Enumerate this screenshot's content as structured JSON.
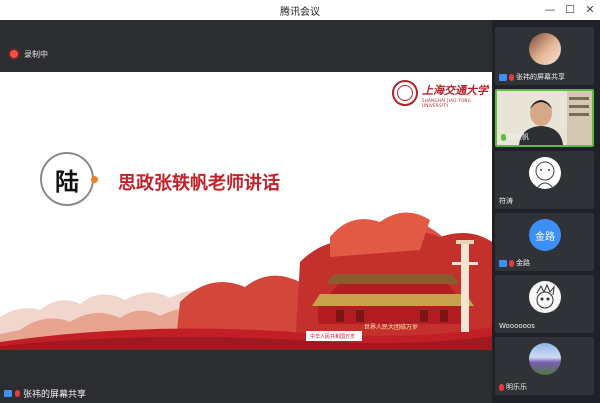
{
  "window": {
    "title": "腾讯会议"
  },
  "recording": {
    "label": "录制中"
  },
  "slide": {
    "logo_cn": "上海交通大学",
    "logo_en": "SHANGHAI JIAO TONG UNIVERSITY",
    "circle_char": "陆",
    "title": "思政张轶帆老师讲话",
    "banner_text": "世界人民大团结万岁",
    "banner_text2": "中华人民共和国万岁"
  },
  "participants": [
    {
      "name": "张祎的屏幕共享",
      "avatar": "photo-avatar",
      "sharing": true
    },
    {
      "name": "张轶帆",
      "avatar": "camera-video",
      "active": true
    },
    {
      "name": "符涛",
      "avatar": "cartoon-avatar"
    },
    {
      "name": "金路",
      "avatar": "initials-avatar",
      "initials": "金路",
      "sharing": true
    },
    {
      "name": "Woooooos",
      "avatar": "cartoon-avatar"
    },
    {
      "name": "明乐乐",
      "avatar": "landscape-avatar"
    }
  ],
  "share_label": "张祎的屏幕共享",
  "colors": {
    "accent_green": "#58c13a",
    "brand_red": "#b2232a",
    "title_red": "#c0242b",
    "avatar_blue": "#3b8ff5"
  }
}
